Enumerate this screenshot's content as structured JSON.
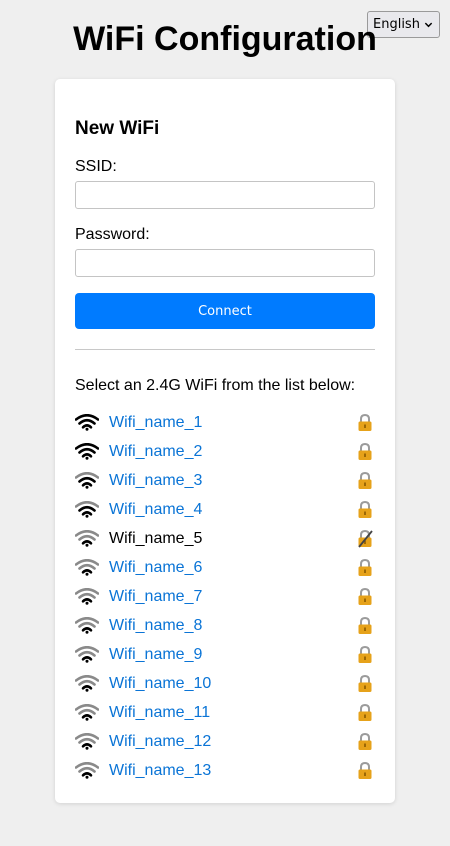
{
  "language": {
    "selected": "English"
  },
  "title": "WiFi Configuration",
  "form": {
    "heading": "New WiFi",
    "ssid_label": "SSID:",
    "ssid_value": "",
    "password_label": "Password:",
    "password_value": "",
    "connect_label": "Connect"
  },
  "list_heading": "Select an 2.4G WiFi from the list below:",
  "networks": [
    {
      "name": "Wifi_name_1",
      "signal_bars": 3,
      "secured": true,
      "link": true
    },
    {
      "name": "Wifi_name_2",
      "signal_bars": 3,
      "secured": true,
      "link": true
    },
    {
      "name": "Wifi_name_3",
      "signal_bars": 2,
      "secured": true,
      "link": true
    },
    {
      "name": "Wifi_name_4",
      "signal_bars": 2,
      "secured": true,
      "link": true
    },
    {
      "name": "Wifi_name_5",
      "signal_bars": 1,
      "secured": false,
      "link": false
    },
    {
      "name": "Wifi_name_6",
      "signal_bars": 1,
      "secured": true,
      "link": true
    },
    {
      "name": "Wifi_name_7",
      "signal_bars": 1,
      "secured": true,
      "link": true
    },
    {
      "name": "Wifi_name_8",
      "signal_bars": 1,
      "secured": true,
      "link": true
    },
    {
      "name": "Wifi_name_9",
      "signal_bars": 1,
      "secured": true,
      "link": true
    },
    {
      "name": "Wifi_name_10",
      "signal_bars": 1,
      "secured": true,
      "link": true
    },
    {
      "name": "Wifi_name_11",
      "signal_bars": 1,
      "secured": true,
      "link": true
    },
    {
      "name": "Wifi_name_12",
      "signal_bars": 1,
      "secured": true,
      "link": true
    },
    {
      "name": "Wifi_name_13",
      "signal_bars": 1,
      "secured": true,
      "link": true
    }
  ],
  "colors": {
    "accent": "#007bff",
    "link": "#0a74d6",
    "background": "#efefef",
    "signal_strong": "#000000",
    "signal_weak": "#8a8a8a",
    "lock": "#e6a21a"
  }
}
